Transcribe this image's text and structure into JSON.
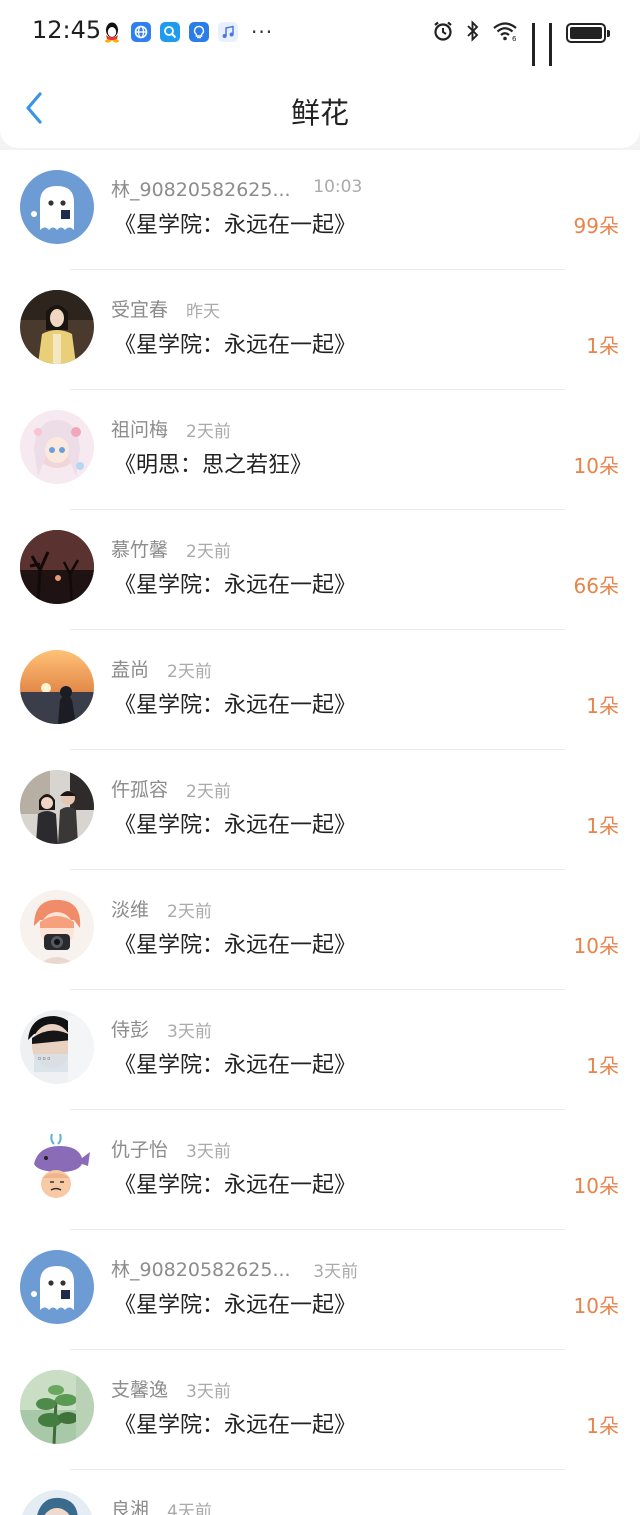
{
  "status_bar": {
    "time": "12:45",
    "dots": "···",
    "notification_icons": [
      "qq-icon",
      "browser-icon",
      "search-app-icon",
      "tips-icon",
      "music-icon"
    ],
    "right_icons": [
      "alarm-icon",
      "bluetooth-icon",
      "wifi-icon",
      "signal-icon",
      "signal-icon",
      "battery-icon"
    ]
  },
  "header": {
    "title": "鲜花",
    "back_icon": "chevron-left-icon",
    "accent_color": "#3a95e8"
  },
  "count_color": "#e8834b",
  "items": [
    {
      "name": "林_90820582625...",
      "time": "10:03",
      "book": "《星学院：永远在一起》",
      "count": "99朵",
      "avatar": "ghost"
    },
    {
      "name": "受宜春",
      "time": "昨天",
      "book": "《星学院：永远在一起》",
      "count": "1朵",
      "avatar": "girl-yellow-coat"
    },
    {
      "name": "祖问梅",
      "time": "2天前",
      "book": "《明思：思之若狂》",
      "count": "10朵",
      "avatar": "anime-girl"
    },
    {
      "name": "慕竹馨",
      "time": "2天前",
      "book": "《星学院：永远在一起》",
      "count": "66朵",
      "avatar": "dark-tree"
    },
    {
      "name": "盍尚",
      "time": "2天前",
      "book": "《星学院：永远在一起》",
      "count": "1朵",
      "avatar": "sunset"
    },
    {
      "name": "仵孤容",
      "time": "2天前",
      "book": "《星学院：永远在一起》",
      "count": "1朵",
      "avatar": "couple"
    },
    {
      "name": "淡维",
      "time": "2天前",
      "book": "《星学院：永远在一起》",
      "count": "10朵",
      "avatar": "camera-boy"
    },
    {
      "name": "侍彭",
      "time": "3天前",
      "book": "《星学院：永远在一起》",
      "count": "1朵",
      "avatar": "boy-portrait"
    },
    {
      "name": "仇子怡",
      "time": "3天前",
      "book": "《星学院：永远在一起》",
      "count": "10朵",
      "avatar": "whale"
    },
    {
      "name": "林_90820582625...",
      "time": "3天前",
      "book": "《星学院：永远在一起》",
      "count": "10朵",
      "avatar": "ghost"
    },
    {
      "name": "支馨逸",
      "time": "3天前",
      "book": "《星学院：永远在一起》",
      "count": "1朵",
      "avatar": "plants"
    },
    {
      "name": "良湘",
      "time": "4天前",
      "book": "",
      "count": "",
      "avatar": "partial"
    }
  ]
}
